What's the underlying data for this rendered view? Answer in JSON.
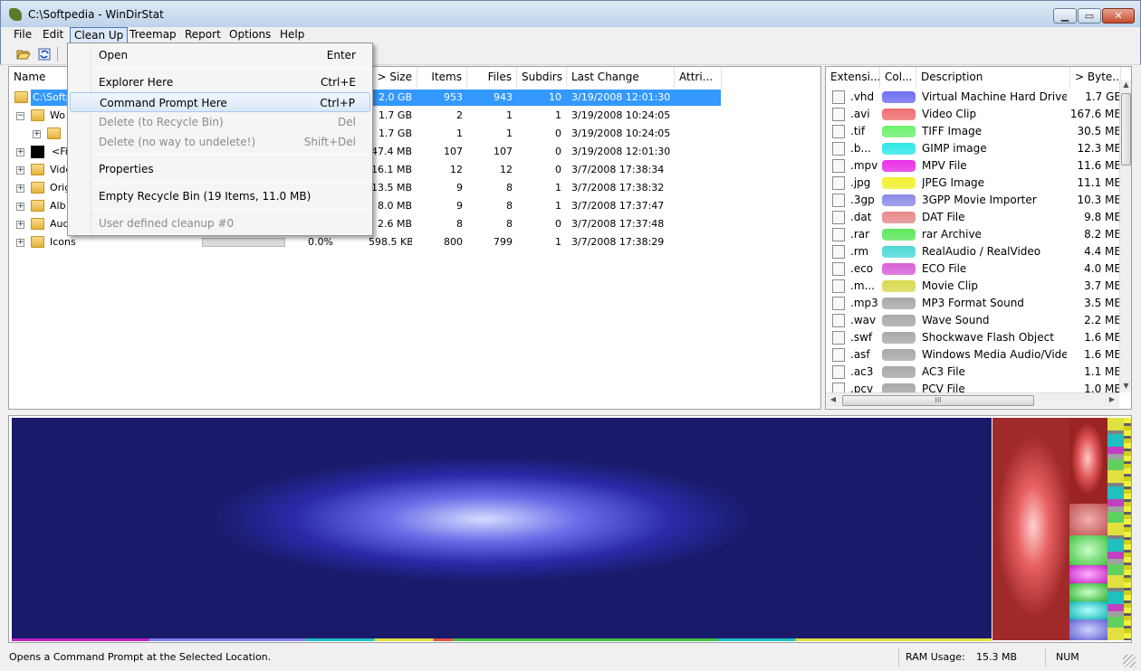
{
  "window": {
    "title": "C:\\Softpedia - WinDirStat"
  },
  "menubar": [
    {
      "label": "File"
    },
    {
      "label": "Edit"
    },
    {
      "label": "Clean Up"
    },
    {
      "label": "Treemap"
    },
    {
      "label": "Report"
    },
    {
      "label": "Options"
    },
    {
      "label": "Help"
    }
  ],
  "dropdown": [
    {
      "label": "Open",
      "shortcut": "Enter",
      "disabled": false
    },
    {
      "sep": true
    },
    {
      "label": "Explorer Here",
      "shortcut": "Ctrl+E",
      "disabled": false
    },
    {
      "label": "Command Prompt Here",
      "shortcut": "Ctrl+P",
      "disabled": false,
      "hover": true
    },
    {
      "label": "Delete (to Recycle Bin)",
      "shortcut": "Del",
      "disabled": true
    },
    {
      "label": "Delete (no way to undelete!)",
      "shortcut": "Shift+Del",
      "disabled": true
    },
    {
      "sep": true
    },
    {
      "label": "Properties",
      "shortcut": "",
      "disabled": false
    },
    {
      "sep": true
    },
    {
      "label": "Empty Recycle Bin (19 Items, 11.0 MB)",
      "shortcut": "",
      "disabled": false
    },
    {
      "sep": true
    },
    {
      "label": "User defined cleanup #0",
      "shortcut": "",
      "disabled": true
    }
  ],
  "dir_columns": [
    "Name",
    "> Size",
    "Items",
    "Files",
    "Subdirs",
    "Last Change",
    "Attri..."
  ],
  "dir_rows": [
    {
      "name": "C:\\Softpedia",
      "size": "2.0 GB",
      "items": "953",
      "files": "943",
      "subdirs": "10",
      "changed": "3/19/2008  12:01:30",
      "selected": true,
      "expander": ""
    },
    {
      "name": "Wo",
      "size": "1.7 GB",
      "items": "2",
      "files": "1",
      "subdirs": "1",
      "changed": "3/19/2008  10:24:05",
      "expander": "−"
    },
    {
      "name": "",
      "size": "1.7 GB",
      "items": "1",
      "files": "1",
      "subdirs": "0",
      "changed": "3/19/2008  10:24:05",
      "expander": "+"
    },
    {
      "name": "<Fil",
      "size": "47.4 MB",
      "items": "107",
      "files": "107",
      "subdirs": "0",
      "changed": "3/19/2008  12:01:30",
      "expander": "+"
    },
    {
      "name": "Vide",
      "size": "16.1 MB",
      "items": "12",
      "files": "12",
      "subdirs": "0",
      "changed": "3/7/2008  17:38:34",
      "expander": "+"
    },
    {
      "name": "Orig",
      "size": "13.5 MB",
      "items": "9",
      "files": "8",
      "subdirs": "1",
      "changed": "3/7/2008  17:38:32",
      "expander": "+"
    },
    {
      "name": "Alb",
      "size": "8.0 MB",
      "items": "9",
      "files": "8",
      "subdirs": "1",
      "changed": "3/7/2008  17:37:47",
      "expander": "+"
    },
    {
      "name": "Aud",
      "size": "2.6 MB",
      "items": "8",
      "files": "8",
      "subdirs": "0",
      "changed": "3/7/2008  17:37:48",
      "expander": "+"
    },
    {
      "name": "Icons",
      "size": "598.5 KB",
      "items": "800",
      "files": "799",
      "subdirs": "1",
      "changed": "3/7/2008  17:38:29",
      "percent": "0.0%",
      "expander": "+"
    }
  ],
  "ext_columns": [
    "Extensi...",
    "Col...",
    "Description",
    "> Byte..."
  ],
  "ext_rows": [
    {
      "ext": ".vhd",
      "color": "#6e6ef0",
      "desc": "Virtual Machine Hard Drive I...",
      "bytes": "1.7 GE"
    },
    {
      "ext": ".avi",
      "color": "#f06e6e",
      "desc": "Video Clip",
      "bytes": "167.6 ME"
    },
    {
      "ext": ".tif",
      "color": "#6ef06e",
      "desc": "TIFF Image",
      "bytes": "30.5 ME"
    },
    {
      "ext": ".b...",
      "color": "#2ee8e8",
      "desc": "GIMP image",
      "bytes": "12.3 ME"
    },
    {
      "ext": ".mpv",
      "color": "#e82ee8",
      "desc": "MPV File",
      "bytes": "11.6 ME"
    },
    {
      "ext": ".jpg",
      "color": "#f0f02e",
      "desc": "JPEG Image",
      "bytes": "11.1 ME"
    },
    {
      "ext": ".3gp",
      "color": "#8a8ae6",
      "desc": "3GPP Movie Importer",
      "bytes": "10.3 ME"
    },
    {
      "ext": ".dat",
      "color": "#e68a8a",
      "desc": "DAT File",
      "bytes": "9.8 ME"
    },
    {
      "ext": ".rar",
      "color": "#5ee85e",
      "desc": "rar Archive",
      "bytes": "8.2 ME"
    },
    {
      "ext": ".rm",
      "color": "#4ed8d8",
      "desc": "RealAudio / RealVideo",
      "bytes": "4.4 ME"
    },
    {
      "ext": ".eco",
      "color": "#d860d8",
      "desc": "ECO File",
      "bytes": "4.0 ME"
    },
    {
      "ext": ".m...",
      "color": "#d8d850",
      "desc": "Movie Clip",
      "bytes": "3.7 ME"
    },
    {
      "ext": ".mp3",
      "color": "#a8a8a8",
      "desc": "MP3 Format Sound",
      "bytes": "3.5 ME"
    },
    {
      "ext": ".wav",
      "color": "#a8a8a8",
      "desc": "Wave Sound",
      "bytes": "2.2 ME"
    },
    {
      "ext": ".swf",
      "color": "#a8a8a8",
      "desc": "Shockwave Flash Object",
      "bytes": "1.6 ME"
    },
    {
      "ext": ".asf",
      "color": "#a8a8a8",
      "desc": "Windows Media Audio/Vide...",
      "bytes": "1.6 ME"
    },
    {
      "ext": ".ac3",
      "color": "#a8a8a8",
      "desc": "AC3 File",
      "bytes": "1.1 ME"
    },
    {
      "ext": ".pcv",
      "color": "#a8a8a8",
      "desc": "PCV File",
      "bytes": "1.0 ME"
    }
  ],
  "scroll_glyph": "III",
  "status": {
    "message": "Opens a Command Prompt at the Selected Location.",
    "ram_label": "RAM Usage:",
    "ram_value": "15.3 MB",
    "num": "NUM"
  },
  "colors": {
    "treemap_main": "#1a1a70",
    "treemap_avi": "#e05a5a",
    "selection": "#3399ff"
  }
}
